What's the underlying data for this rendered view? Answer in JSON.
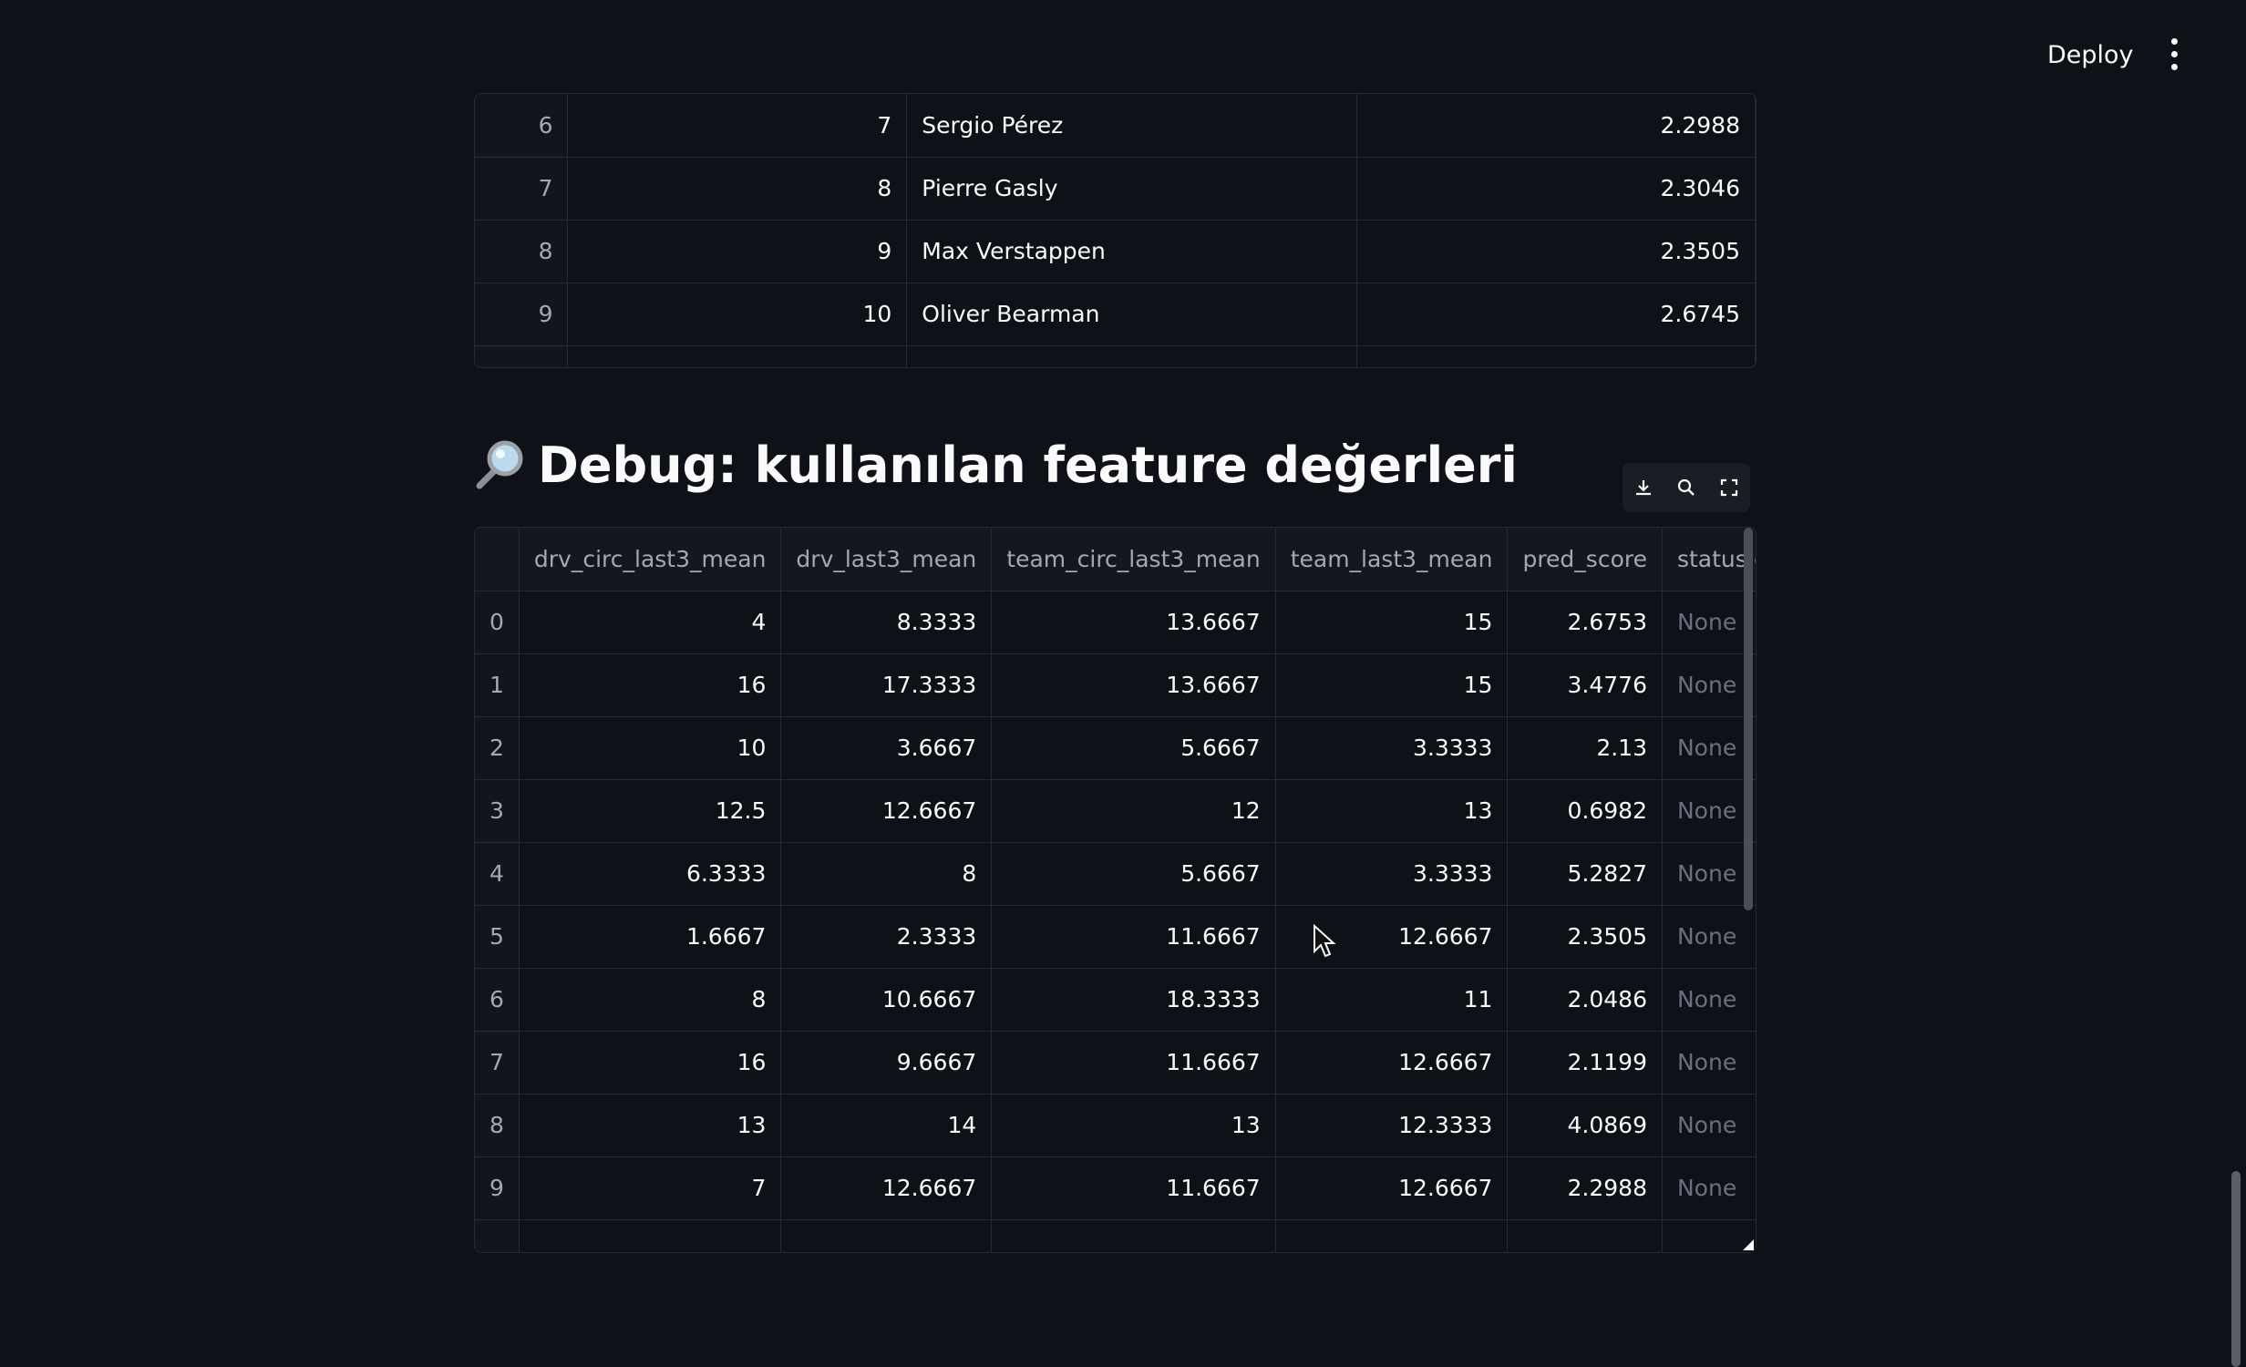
{
  "header": {
    "deploy_label": "Deploy"
  },
  "table1": {
    "rows": [
      {
        "index": "6",
        "rank": "7",
        "driver": "Sergio Pérez",
        "score": "2.2988"
      },
      {
        "index": "7",
        "rank": "8",
        "driver": "Pierre Gasly",
        "score": "2.3046"
      },
      {
        "index": "8",
        "rank": "9",
        "driver": "Max Verstappen",
        "score": "2.3505"
      },
      {
        "index": "9",
        "rank": "10",
        "driver": "Oliver Bearman",
        "score": "2.6745"
      }
    ]
  },
  "section": {
    "icon": "magnifying-glass-icon",
    "title": "Debug: kullanılan feature değerleri"
  },
  "toolbar": {
    "icons": [
      "download-icon",
      "search-icon",
      "fullscreen-icon"
    ]
  },
  "table2": {
    "columns": [
      "drv_circ_last3_mean",
      "drv_last3_mean",
      "team_circ_last3_mean",
      "team_last3_mean",
      "pred_score",
      "statusId"
    ],
    "rows": [
      {
        "index": "0",
        "c1": "4",
        "c2": "8.3333",
        "c3": "13.6667",
        "c4": "15",
        "c5": "2.6753",
        "c6": "None"
      },
      {
        "index": "1",
        "c1": "16",
        "c2": "17.3333",
        "c3": "13.6667",
        "c4": "15",
        "c5": "3.4776",
        "c6": "None"
      },
      {
        "index": "2",
        "c1": "10",
        "c2": "3.6667",
        "c3": "5.6667",
        "c4": "3.3333",
        "c5": "2.13",
        "c6": "None"
      },
      {
        "index": "3",
        "c1": "12.5",
        "c2": "12.6667",
        "c3": "12",
        "c4": "13",
        "c5": "0.6982",
        "c6": "None"
      },
      {
        "index": "4",
        "c1": "6.3333",
        "c2": "8",
        "c3": "5.6667",
        "c4": "3.3333",
        "c5": "5.2827",
        "c6": "None"
      },
      {
        "index": "5",
        "c1": "1.6667",
        "c2": "2.3333",
        "c3": "11.6667",
        "c4": "12.6667",
        "c5": "2.3505",
        "c6": "None"
      },
      {
        "index": "6",
        "c1": "8",
        "c2": "10.6667",
        "c3": "18.3333",
        "c4": "11",
        "c5": "2.0486",
        "c6": "None"
      },
      {
        "index": "7",
        "c1": "16",
        "c2": "9.6667",
        "c3": "11.6667",
        "c4": "12.6667",
        "c5": "2.1199",
        "c6": "None"
      },
      {
        "index": "8",
        "c1": "13",
        "c2": "14",
        "c3": "13",
        "c4": "12.3333",
        "c5": "4.0869",
        "c6": "None"
      },
      {
        "index": "9",
        "c1": "7",
        "c2": "12.6667",
        "c3": "11.6667",
        "c4": "12.6667",
        "c5": "2.2988",
        "c6": "None"
      }
    ]
  }
}
